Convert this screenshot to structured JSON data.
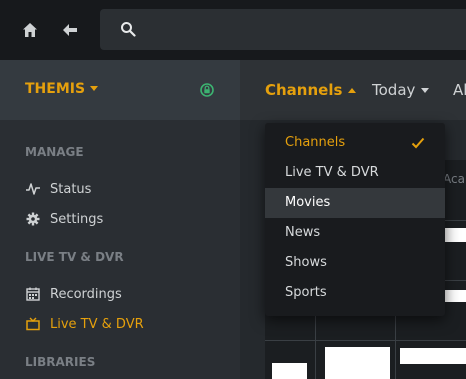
{
  "topbar": {
    "search": {
      "placeholder": ""
    }
  },
  "sidebar": {
    "server": {
      "name": "THEMIS"
    },
    "sections": [
      {
        "label": "MANAGE"
      },
      {
        "label": "LIVE TV & DVR"
      },
      {
        "label": "LIBRARIES"
      }
    ],
    "items": [
      {
        "label": "Status"
      },
      {
        "label": "Settings"
      },
      {
        "label": "Recordings"
      },
      {
        "label": "Live TV & DVR"
      }
    ]
  },
  "main": {
    "tabs": [
      {
        "label": "Channels"
      },
      {
        "label": "Today"
      },
      {
        "label": "Al"
      }
    ],
    "grid": {
      "header_fragment": "Aca"
    }
  },
  "dropdown": {
    "items": [
      {
        "label": "Channels"
      },
      {
        "label": "Live TV & DVR"
      },
      {
        "label": "Movies"
      },
      {
        "label": "News"
      },
      {
        "label": "Shows"
      },
      {
        "label": "Sports"
      }
    ]
  },
  "colors": {
    "accent": "#e5a00d",
    "lock_icon": "#3cb371"
  }
}
